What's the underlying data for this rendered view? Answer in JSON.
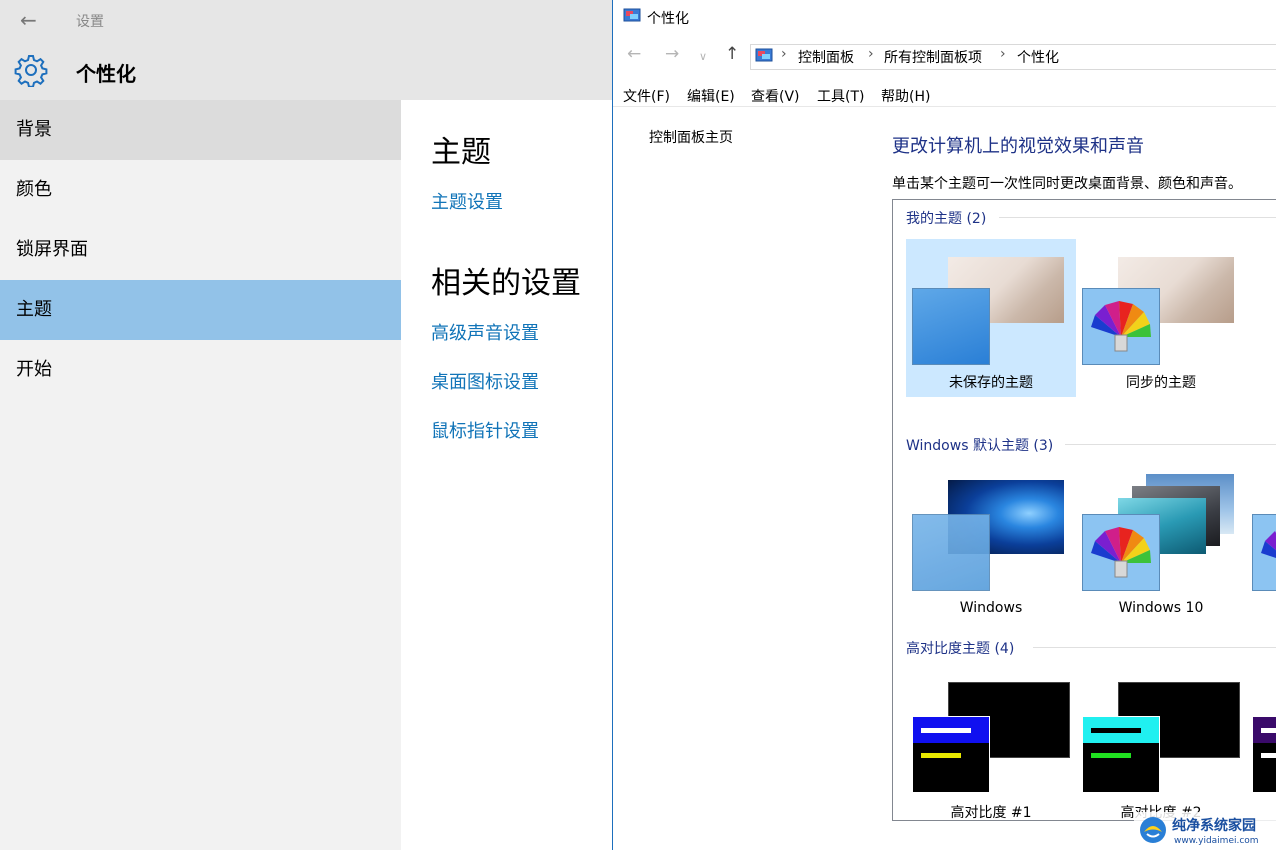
{
  "settings": {
    "window_title": "设置",
    "header_title": "个性化",
    "nav": [
      {
        "label": "背景",
        "state": "hover"
      },
      {
        "label": "颜色",
        "state": ""
      },
      {
        "label": "锁屏界面",
        "state": ""
      },
      {
        "label": "主题",
        "state": "selected"
      },
      {
        "label": "开始",
        "state": ""
      }
    ],
    "content": {
      "section1_title": "主题",
      "theme_settings_link": "主题设置",
      "section2_title": "相关的设置",
      "links": [
        "高级声音设置",
        "桌面图标设置",
        "鼠标指针设置"
      ]
    }
  },
  "control_panel": {
    "window_title": "个性化",
    "breadcrumb": [
      "控制面板",
      "所有控制面板项",
      "个性化"
    ],
    "menu": [
      "文件(F)",
      "编辑(E)",
      "查看(V)",
      "工具(T)",
      "帮助(H)"
    ],
    "side_link": "控制面板主页",
    "main_title": "更改计算机上的视觉效果和声音",
    "main_desc": "单击某个主题可一次性同时更改桌面背景、颜色和声音。",
    "groups": [
      {
        "label": "我的主题 (2)",
        "themes": [
          "未保存的主题",
          "同步的主题"
        ]
      },
      {
        "label": "Windows 默认主题 (3)",
        "themes": [
          "Windows",
          "Windows 10"
        ]
      },
      {
        "label": "高对比度主题 (4)",
        "themes": [
          "高对比度 #1",
          "高对比度 #2"
        ]
      }
    ]
  },
  "watermark": {
    "name": "纯净系统家园",
    "url": "www.yidaimei.com"
  },
  "colors": {
    "accent_link": "#1174b8",
    "selected_nav": "#92c2e8",
    "selected_theme": "#cce8ff",
    "group_label": "#1e3287"
  }
}
